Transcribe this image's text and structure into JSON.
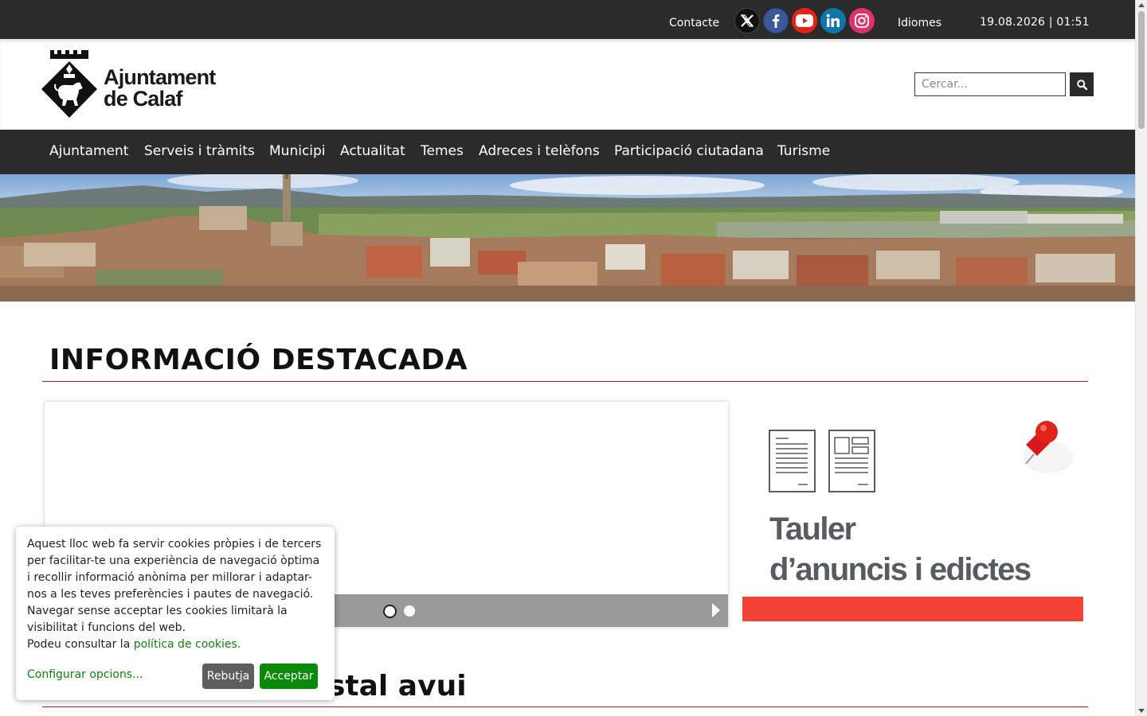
{
  "topbar": {
    "contact_label": "Contacte",
    "social": [
      {
        "name": "x-twitter-icon",
        "color": "#000000"
      },
      {
        "name": "facebook-icon",
        "color": "#3b5998"
      },
      {
        "name": "youtube-icon",
        "color": "#e62117"
      },
      {
        "name": "linkedin-icon",
        "color": "#0e76a8"
      },
      {
        "name": "instagram-icon",
        "color": "#e1306c"
      }
    ],
    "languages_label": "Idiomes",
    "datetime": "19.08.2026 | 01:51"
  },
  "header": {
    "logo_line1": "Ajuntament",
    "logo_line2": "de Calaf",
    "search_placeholder": "Cercar..."
  },
  "nav": {
    "items": [
      "Ajuntament",
      "Serveis i tràmits",
      "Municipi",
      "Actualitat",
      "Temes",
      "Adreces i telèfons",
      "Participació ciutadana",
      "Turisme"
    ]
  },
  "main": {
    "featured_title": "INFORMACIÓ DESTACADA",
    "slider": {
      "slide_count": 2,
      "active_slide": 1
    },
    "tauler": {
      "line1": "Tauler",
      "line2": "d’anuncis i edictes"
    },
    "second_title_fragment": "stal avui"
  },
  "cookies": {
    "text_lines": [
      "Aquest lloc web fa servir cookies pròpies i de tercers",
      "per facilitar-te una experiència de navegació òptima",
      "i recollir informació anònima per millorar i adaptar-",
      "nos a les teves preferències i pautes de navegació.",
      "Navegar sense acceptar les cookies limitarà la",
      "visibilitat i funcions del web."
    ],
    "policy_prefix": "Podeu consultar la ",
    "policy_link": "política de cookies",
    "policy_suffix": ".",
    "configure_label": "Configurar opcions...",
    "reject_label": "Rebutja",
    "accept_label": "Acceptar"
  },
  "colors": {
    "dark_bar": "#2b2b2b",
    "accent_red": "#c0171f",
    "tauler_red": "#f44336",
    "cookie_green": "#0a8a0a"
  }
}
